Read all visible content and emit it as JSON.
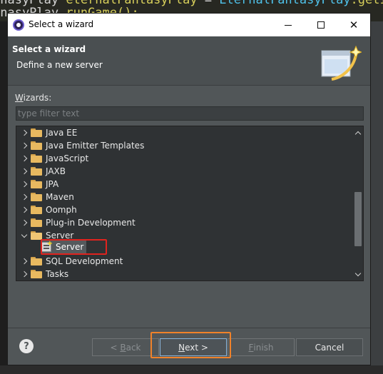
{
  "background_code": {
    "line1": {
      "part1": "tnasyPlay",
      "part2": " eternalFantasyPlay",
      "part3": " = ",
      "part4": "EternalFantasyPlay",
      "part5": ".getI"
    },
    "line2": {
      "part1": "tnasyPlay",
      "part2": ".runGame();"
    }
  },
  "window": {
    "title": "Select a wizard",
    "minimize_label": "—",
    "close_label": "✕"
  },
  "header": {
    "title": "Select a wizard",
    "subtitle": "Define a new server"
  },
  "wizards": {
    "label_first": "W",
    "label_rest": "izards:",
    "filter_placeholder": "type filter text",
    "filter_value": ""
  },
  "tree": {
    "items": [
      {
        "label": "Java EE",
        "expanded": false
      },
      {
        "label": "Java Emitter Templates",
        "expanded": false
      },
      {
        "label": "JavaScript",
        "expanded": false
      },
      {
        "label": "JAXB",
        "expanded": false
      },
      {
        "label": "JPA",
        "expanded": false
      },
      {
        "label": "Maven",
        "expanded": false
      },
      {
        "label": "Oomph",
        "expanded": false
      },
      {
        "label": "Plug-in Development",
        "expanded": false
      },
      {
        "label": "Server",
        "expanded": true
      },
      {
        "label": "SQL Development",
        "expanded": false
      },
      {
        "label": "Tasks",
        "expanded": false
      }
    ],
    "selected_child": "Server"
  },
  "buttons": {
    "help": "?",
    "back_prefix": "< ",
    "back_ul": "B",
    "back_rest": "ack",
    "next_ul": "N",
    "next_rest": "ext >",
    "finish_ul": "F",
    "finish_rest": "inish",
    "cancel": "Cancel"
  },
  "colors": {
    "dialog_bg": "#515658",
    "tree_bg": "#2f3234",
    "highlight_red": "#e0231e",
    "highlight_orange": "#f0822a",
    "folder": "#e8b960"
  }
}
